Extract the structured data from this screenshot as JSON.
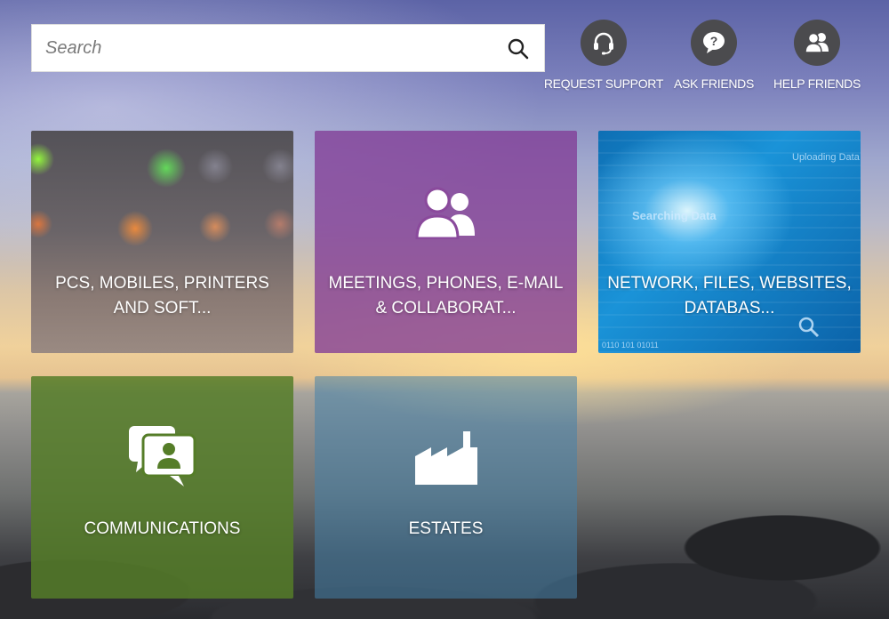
{
  "search": {
    "placeholder": "Search",
    "icon": "search-icon"
  },
  "actions": [
    {
      "label": "REQUEST SUPPORT",
      "icon": "headset-icon"
    },
    {
      "label": "ASK FRIENDS",
      "icon": "question-bubble-icon"
    },
    {
      "label": "HELP FRIENDS",
      "icon": "users-icon"
    }
  ],
  "tiles": [
    {
      "label": "PCS, MOBILES, PRINTERS AND SOFT...",
      "color": "#5c5660"
    },
    {
      "label": "MEETINGS, PHONES, E-MAIL & COLLABORAT...",
      "icon": "users-icon",
      "color": "#823c96"
    },
    {
      "label": "NETWORK, FILES, WEBSITES, DATABAS...",
      "color": "#1a93d8",
      "image_text": {
        "heading": "Searching Data",
        "upload": "Uploading Data",
        "digits": "0110 101 01011"
      }
    },
    {
      "label": "COMMUNICATIONS",
      "icon": "chat-user-icon",
      "color": "#557d28"
    },
    {
      "label": "ESTATES",
      "icon": "factory-icon",
      "color": "#4682aa"
    }
  ]
}
